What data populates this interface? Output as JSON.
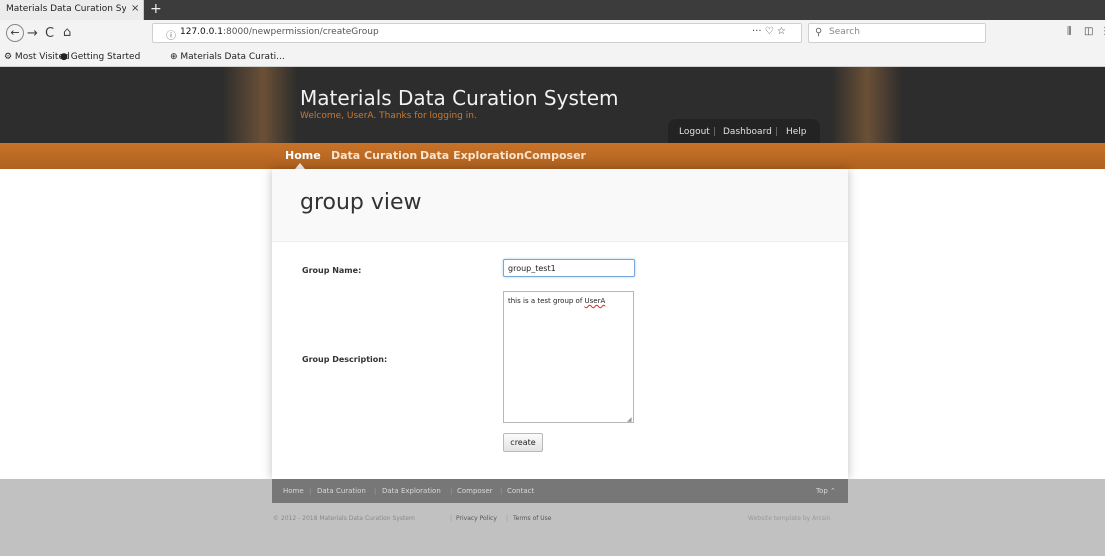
{
  "browser": {
    "tab_title": "Materials Data Curation Sy...",
    "tab_close": "×",
    "new_tab": "+",
    "back_icon": "←",
    "forward_icon": "→",
    "reload_icon": "C",
    "home_icon": "⌂",
    "info_icon": "ⓘ",
    "url_host": "127.0.0.1",
    "url_rest": ":8000/newpermission/createGroup",
    "page_actions": "··· ♡ ☆",
    "search_icon": "⚲",
    "search_placeholder": "Search",
    "library_icon": "⫼",
    "sidebar_icon": "◫",
    "menu_icon": "⋮"
  },
  "bookmarks": {
    "most_visited": "⚙ Most Visited",
    "getting_started": "● Getting Started",
    "mdcs": "⊕ Materials Data Curati..."
  },
  "header": {
    "site_title": "Materials Data Curation System",
    "welcome": "Welcome, UserA. Thanks for logging in.",
    "links": {
      "logout": "Logout",
      "dashboard": "Dashboard",
      "help": "Help",
      "separator": "|"
    }
  },
  "nav": {
    "home": "Home",
    "data_curation": "Data Curation",
    "data_exploration": "Data Exploration",
    "composer": "Composer"
  },
  "main": {
    "page_title": "group view",
    "form": {
      "group_name_label": "Group Name:",
      "group_name_value": "group_test1",
      "group_description_label": "Group Description:",
      "group_description_prefix": "this is a test group of ",
      "group_description_user": "UserA",
      "create_label": "create"
    }
  },
  "footer": {
    "links": {
      "home": "Home",
      "data_curation": "Data Curation",
      "data_exploration": "Data Exploration",
      "composer": "Composer",
      "contact": "Contact",
      "top": "Top ⌃",
      "separator": "|"
    },
    "copyright": "© 2012 - 2018 Materials Data Curation System",
    "privacy": "Privacy Policy",
    "terms": "Terms of Use",
    "template_credit": "Website template by Arcsin"
  }
}
